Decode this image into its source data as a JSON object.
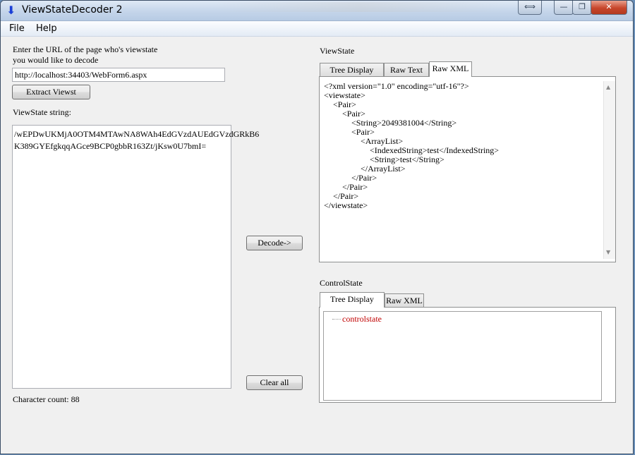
{
  "window": {
    "title": "ViewStateDecoder 2"
  },
  "titlebar_buttons": {
    "switch": "⟺",
    "minimize": "—",
    "maximize": "❐",
    "close": "✕"
  },
  "menu": [
    "File",
    "Help"
  ],
  "left": {
    "url_prompt_line1": "Enter the URL of the page who's viewstate",
    "url_prompt_line2": "you would like to decode",
    "url_value": "http://localhost:34403/WebForm6.aspx",
    "extract_button": "Extract Viewst",
    "viewstate_label": "ViewState string:",
    "viewstate_line1": "/wEPDwUKMjA0OTM4MTAwNA8WAh4EdGVzdAUEdGVzdGRkB6",
    "viewstate_line2": "K389GYEfgkqqAGce9BCP0gbbR163Zt/jKsw0U7bmI=",
    "char_count": "Character count: 88"
  },
  "middle": {
    "decode_button": "Decode->",
    "clear_button": "Clear all"
  },
  "viewstate": {
    "label": "ViewState",
    "tabs": [
      "Tree Display",
      "Raw Text",
      "Raw XML"
    ],
    "active_tab": "Raw XML",
    "xml_lines": [
      "<?xml version=\"1.0\" encoding=\"utf-16\"?>",
      "<viewstate>",
      "<Pair>",
      "<Pair>",
      "<String>2049381004</String>",
      "<Pair>",
      "<ArrayList>",
      "<IndexedString>test</IndexedString>",
      "<String>test</String>",
      "</ArrayList>",
      "</Pair>",
      "</Pair>",
      "</Pair>",
      "</viewstate>"
    ]
  },
  "controlstate": {
    "label": "ControlState",
    "tabs": [
      "Tree Display",
      "Raw XML"
    ],
    "active_tab": "Tree Display",
    "tree_root": "controlstate",
    "tree_root_color": "#c00000"
  },
  "colors": {
    "window_bg": "#f0f0f0",
    "titlebar": "#c4d5ea",
    "close_button": "#c7462b",
    "icon_blue": "#1a3fd6"
  },
  "icons": {
    "app": "down-arrow-icon"
  }
}
